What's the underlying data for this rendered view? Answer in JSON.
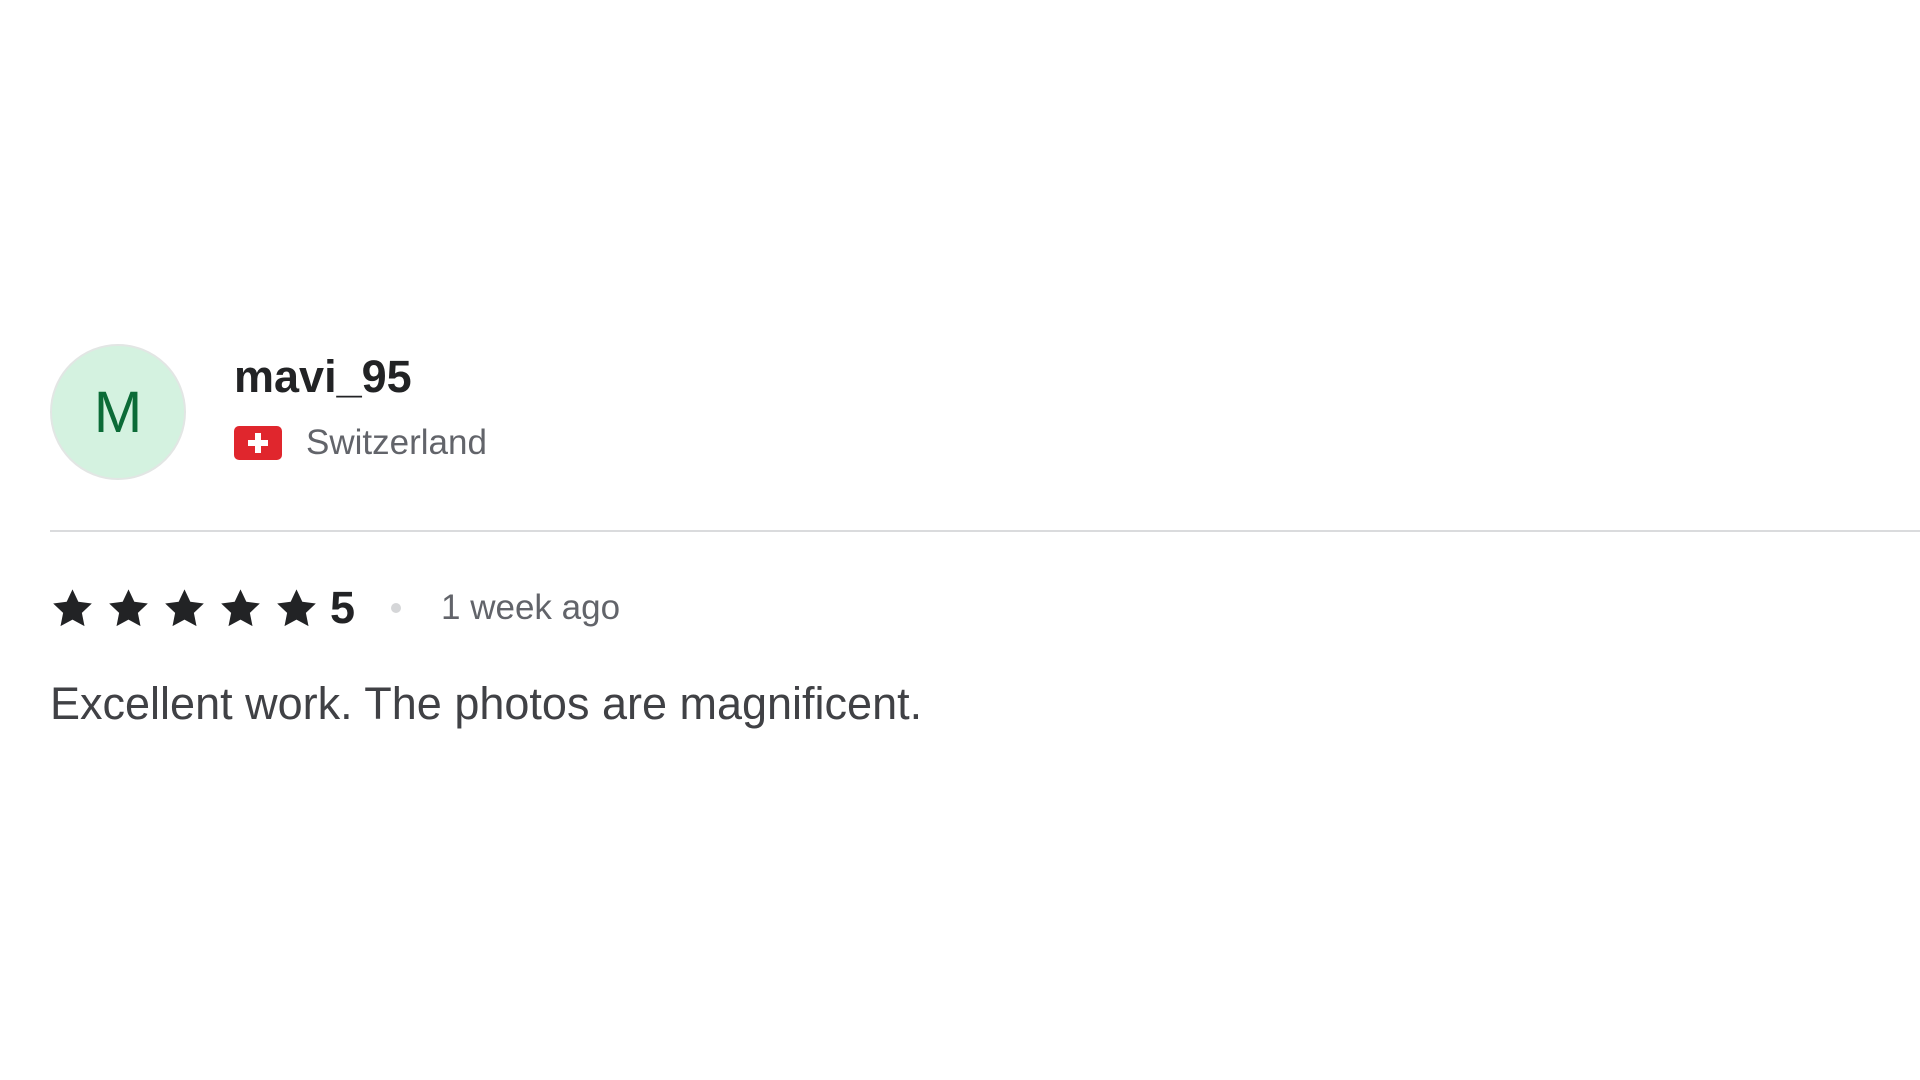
{
  "reviewer": {
    "avatar_initial": "M",
    "username": "mavi_95",
    "country": "Switzerland",
    "flag_icon": "switzerland-flag-icon"
  },
  "rating": {
    "stars": 5,
    "value": "5",
    "time_ago": "1 week ago"
  },
  "review": {
    "text": "Excellent work. The photos are magnificent."
  },
  "colors": {
    "avatar_bg": "#d4f2e0",
    "avatar_text": "#0b6b37",
    "star": "#222325",
    "flag_red": "#e0262d",
    "muted_text": "#62646a"
  }
}
